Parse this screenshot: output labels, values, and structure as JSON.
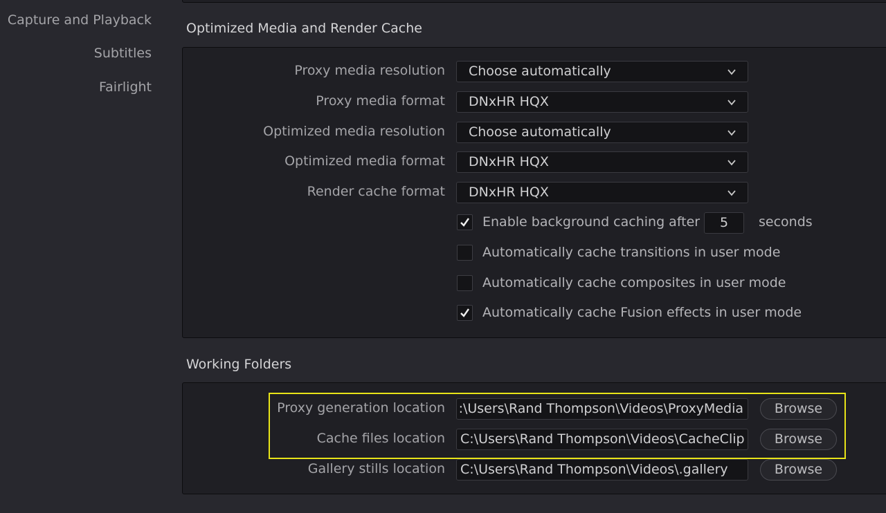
{
  "sidebar": {
    "items": [
      {
        "label": "Capture and Playback"
      },
      {
        "label": "Subtitles"
      },
      {
        "label": "Fairlight"
      }
    ]
  },
  "optimized_section": {
    "title": "Optimized Media and Render Cache",
    "fields": [
      {
        "label": "Proxy media resolution",
        "value": "Choose automatically"
      },
      {
        "label": "Proxy media format",
        "value": "DNxHR HQX"
      },
      {
        "label": "Optimized media resolution",
        "value": "Choose automatically"
      },
      {
        "label": "Optimized media format",
        "value": "DNxHR HQX"
      },
      {
        "label": "Render cache format",
        "value": "DNxHR HQX"
      }
    ],
    "background_caching": {
      "label": "Enable background caching after",
      "value": "5",
      "unit": "seconds",
      "checked": true
    },
    "checkboxes": [
      {
        "label": "Automatically cache transitions in user mode",
        "checked": false
      },
      {
        "label": "Automatically cache composites in user mode",
        "checked": false
      },
      {
        "label": "Automatically cache Fusion effects in user mode",
        "checked": true
      }
    ]
  },
  "working_folders": {
    "title": "Working Folders",
    "rows": [
      {
        "label": "Proxy generation location",
        "value": ":\\Users\\Rand Thompson\\Videos\\ProxyMedia",
        "button": "Browse"
      },
      {
        "label": "Cache files location",
        "value": "C:\\Users\\Rand Thompson\\Videos\\CacheClip",
        "button": "Browse"
      },
      {
        "label": "Gallery stills location",
        "value": "C:\\Users\\Rand Thompson\\Videos\\.gallery",
        "button": "Browse"
      }
    ]
  },
  "colors": {
    "background": "#28282e",
    "panel": "#1f1f24",
    "field": "#141417",
    "highlight": "#e8e418"
  }
}
